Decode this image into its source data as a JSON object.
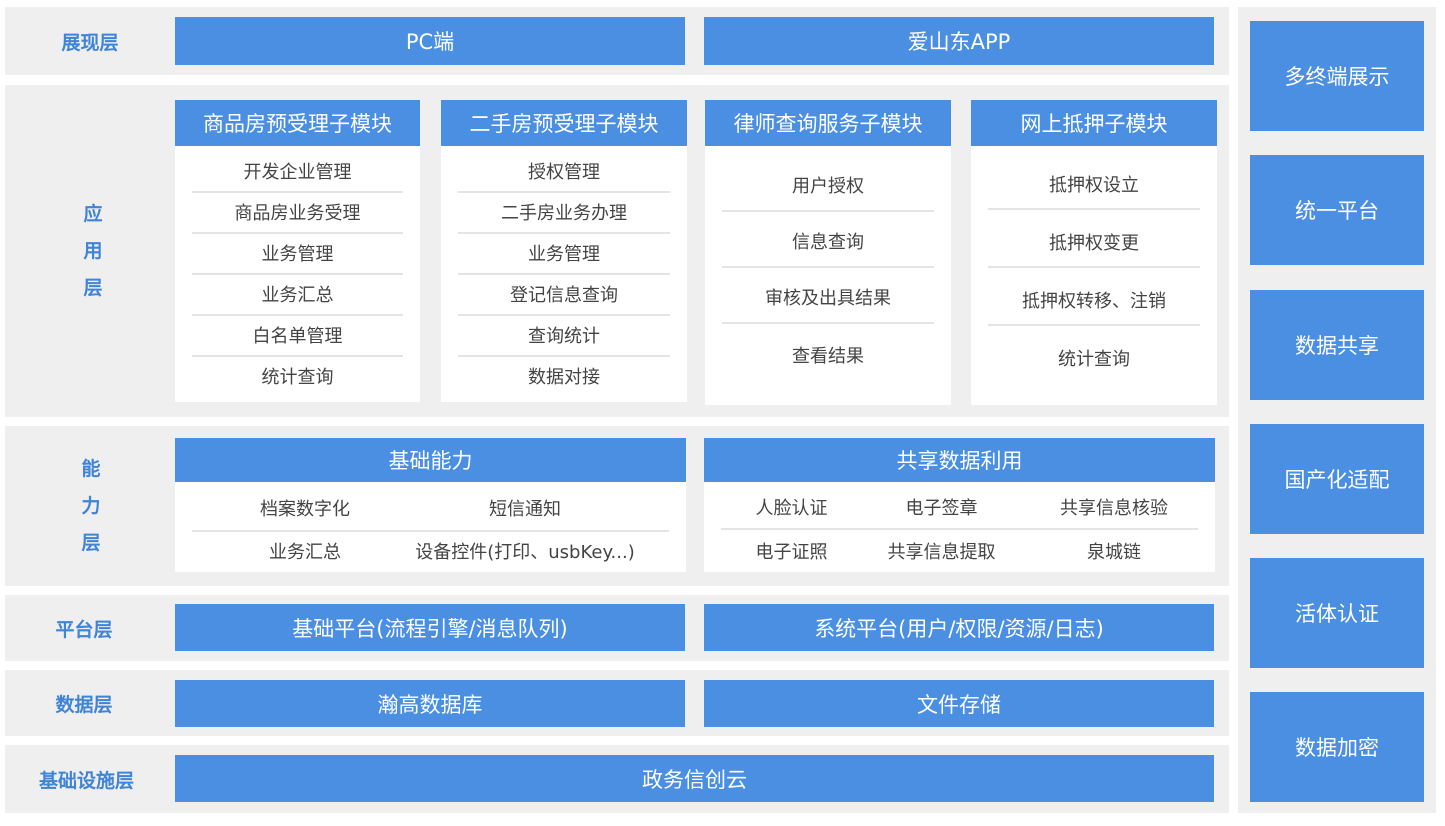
{
  "layers": {
    "presentation": {
      "label": "展现层",
      "items": [
        "PC端",
        "爱山东APP"
      ]
    },
    "application": {
      "label_chars": [
        "应",
        "用",
        "层"
      ],
      "modules": [
        {
          "title": "商品房预受理子模块",
          "items": [
            "开发企业管理",
            "商品房业务受理",
            "业务管理",
            "业务汇总",
            "白名单管理",
            "统计查询"
          ]
        },
        {
          "title": "二手房预受理子模块",
          "items": [
            "授权管理",
            "二手房业务办理",
            "业务管理",
            "登记信息查询",
            "查询统计",
            "数据对接"
          ]
        },
        {
          "title": "律师查询服务子模块",
          "items": [
            "用户授权",
            "信息查询",
            "审核及出具结果",
            "查看结果"
          ]
        },
        {
          "title": "网上抵押子模块",
          "items": [
            "抵押权设立",
            "抵押权变更",
            "抵押权转移、注销",
            "统计查询"
          ]
        }
      ]
    },
    "capability": {
      "label_chars": [
        "能",
        "力",
        "层"
      ],
      "groups": [
        {
          "title": "基础能力",
          "items": [
            "档案数字化",
            "短信通知",
            "业务汇总",
            "设备控件(打印、usbKey...)"
          ]
        },
        {
          "title": "共享数据利用",
          "items": [
            "人脸认证",
            "电子签章",
            "共享信息核验",
            "电子证照",
            "共享信息提取",
            "泉城链"
          ]
        }
      ]
    },
    "platform": {
      "label": "平台层",
      "items": [
        "基础平台(流程引擎/消息队列)",
        "系统平台(用户/权限/资源/日志)"
      ]
    },
    "data": {
      "label": "数据层",
      "items": [
        "瀚高数据库",
        "文件存储"
      ]
    },
    "infrastructure": {
      "label": "基础设施层",
      "items": [
        "政务信创云"
      ]
    }
  },
  "sidebar": {
    "items": [
      "多终端展示",
      "统一平台",
      "数据共享",
      "国产化适配",
      "活体认证",
      "数据加密"
    ]
  },
  "colors": {
    "primary": "#4a8fe2",
    "label": "#3f84d6",
    "band": "#efefef"
  }
}
